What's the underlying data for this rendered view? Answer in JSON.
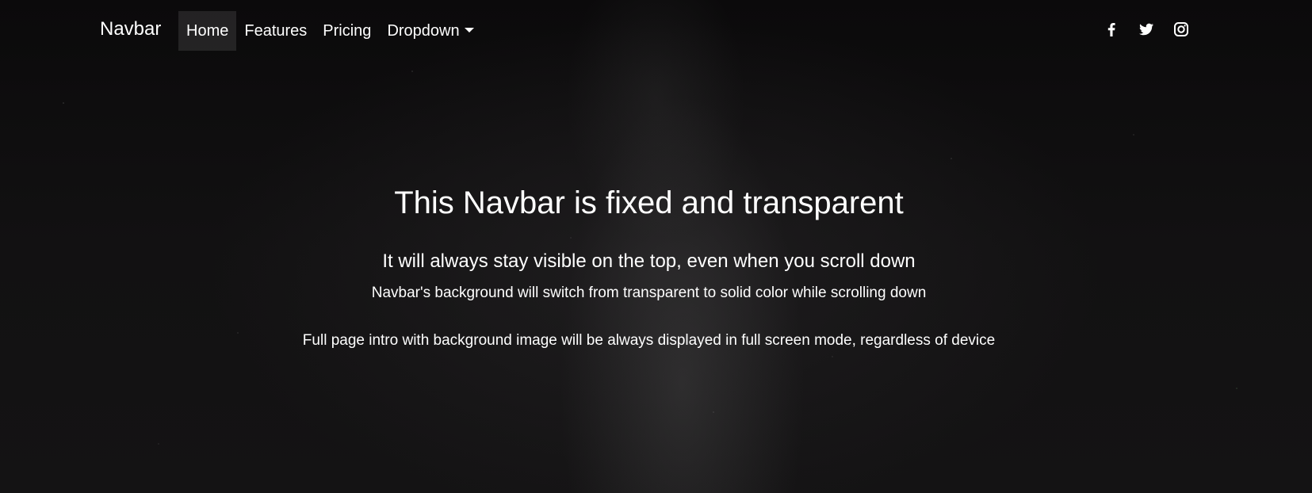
{
  "navbar": {
    "brand": "Navbar",
    "links": [
      {
        "label": "Home",
        "active": true
      },
      {
        "label": "Features",
        "active": false
      },
      {
        "label": "Pricing",
        "active": false
      },
      {
        "label": "Dropdown",
        "active": false,
        "has_caret": true
      }
    ],
    "social_icons": [
      "facebook-icon",
      "twitter-icon",
      "instagram-icon"
    ]
  },
  "hero": {
    "title": "This Navbar is fixed and transparent",
    "subtitle": "It will always stay visible on the top, even when you scroll down",
    "line1": "Navbar's background will switch from transparent to solid color while scrolling down",
    "line2": "Full page intro with background image will be always displayed in full screen mode, regardless of device"
  },
  "colors": {
    "background": "#0f0e0f",
    "text": "#ffffff",
    "active_link_bg": "rgba(255,255,255,0.10)"
  }
}
